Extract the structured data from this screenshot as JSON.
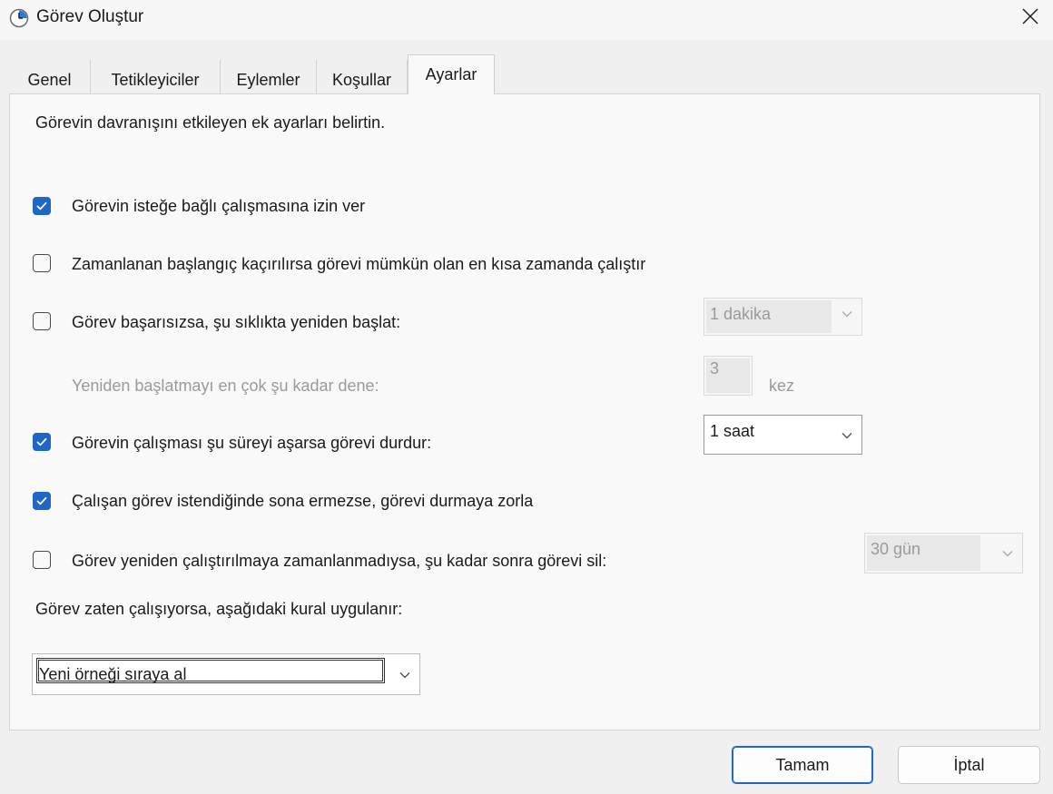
{
  "window": {
    "title": "Görev Oluştur",
    "icon": "clock-icon"
  },
  "tabs": [
    {
      "label": "Genel"
    },
    {
      "label": "Tetikleyiciler"
    },
    {
      "label": "Eylemler"
    },
    {
      "label": "Koşullar"
    },
    {
      "label": "Ayarlar",
      "active": true
    }
  ],
  "settings": {
    "intro": "Görevin davranışını etkileyen ek ayarları belirtin.",
    "allow_on_demand": {
      "label": "Görevin isteğe bağlı çalışmasına izin ver",
      "checked": true
    },
    "run_asap": {
      "label": "Zamanlanan başlangıç kaçırılırsa görevi mümkün olan en kısa zamanda çalıştır",
      "checked": false
    },
    "restart_on_fail": {
      "label": "Görev başarısızsa, şu sıklıkta yeniden başlat:",
      "checked": false,
      "value": "1 dakika"
    },
    "restart_attempts": {
      "label": "Yeniden başlatmayı en çok şu kadar dene:",
      "value": "3",
      "unit": "kez"
    },
    "stop_if_longer": {
      "label": "Görevin çalışması şu süreyi aşarsa görevi durdur:",
      "checked": true,
      "value": "1 saat"
    },
    "force_stop": {
      "label": "Çalışan görev istendiğinde sona ermezse, görevi durmaya zorla",
      "checked": true
    },
    "delete_if_not_scheduled": {
      "label": "Görev yeniden çalıştırılmaya zamanlanmadıysa, şu kadar sonra görevi sil:",
      "checked": false,
      "value": "30 gün"
    },
    "rule_label": "Görev zaten çalışıyorsa, aşağıdaki kural uygulanır:",
    "rule_value": "Yeni örneği sıraya al"
  },
  "buttons": {
    "ok": "Tamam",
    "cancel": "İptal"
  },
  "colors": {
    "accent": "#1f66c7"
  }
}
